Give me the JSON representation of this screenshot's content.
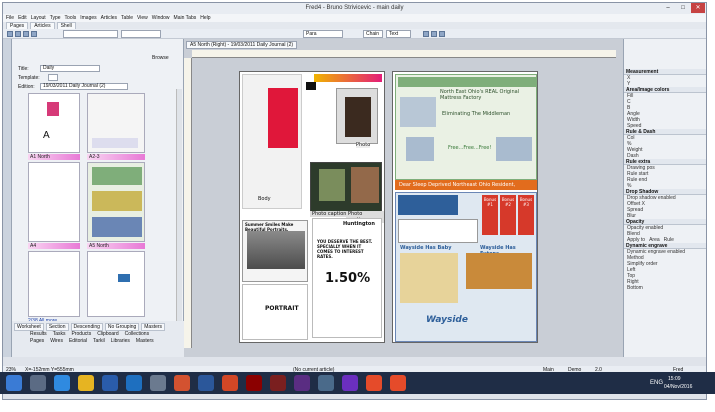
{
  "window": {
    "title": "Fred4 - Bruno Strivicevic - main daily",
    "min": "–",
    "max": "□",
    "close": "✕"
  },
  "menu": [
    "File",
    "Edit",
    "Layout",
    "Type",
    "Tools",
    "Images",
    "Articles",
    "Table",
    "View",
    "Window",
    "Main Tabs",
    "Help"
  ],
  "tabs": [
    "Pages",
    "Articles",
    "Shell"
  ],
  "toolbar": {
    "field1": "Para",
    "field2": "Chain",
    "field3": "Text"
  },
  "left_panel": {
    "browse_label": "Browse",
    "title_label": "Title:",
    "title_value": "Daily",
    "template_label": "Template:",
    "edition_label": "Edition:",
    "edition_value": "19/03/2011 Daily Journal (2)",
    "pages": [
      {
        "label": "A1 North"
      },
      {
        "label": "A2-3"
      },
      {
        "label": "A4"
      },
      {
        "label": "A5 North"
      }
    ],
    "more": "2/38 All more"
  },
  "bottom_left": {
    "row1": [
      "Worksheet",
      "Section",
      "Descending",
      "No Grouping"
    ],
    "row1_b": "Masters",
    "row2": [
      "Results",
      "Tasks",
      "Products",
      "Clipboard",
      "Collections"
    ],
    "row3": [
      "Pages",
      "Wires",
      "Editorial",
      "Tarkil",
      "Libraries",
      "Masters"
    ]
  },
  "document_tab": "A5 North (Right) - 19/03/2011 Daily Journal (2)",
  "ads": {
    "photo_caption": "Photo caption",
    "photo": "Photo",
    "body": "Body",
    "yes_deserve": "YOU DESERVE THE BEST. SPECIALLY WHEN IT COMES TO INTEREST RATES.",
    "huntington": "Huntington",
    "rate": "1.50%",
    "portrait": "PORTRAIT",
    "summer": "Summer Smiles Make Beautiful Portraits.",
    "factory": "North East Ohio's REAL Original Mattress Factory",
    "waste": "Eliminating The Middleman",
    "free": "Free...Free...Free!",
    "sleep": "Dear Sleep Deprived Northeast Ohio Resident,",
    "bonus1": "Bonus #1",
    "bonus2": "Bonus #2",
    "bonus3": "Bonus #3",
    "waysidebay": "Wayside Has Baby",
    "waysidefut": "Wayside Has Futons",
    "wayside": "Wayside"
  },
  "right_panel": {
    "sections": [
      {
        "title": "Measurement",
        "rows": [
          "X",
          "Y"
        ]
      },
      {
        "title": "Area/Image colors",
        "rows": [
          "Fill",
          "C",
          "B",
          "Angle",
          "Width",
          "Speed"
        ]
      },
      {
        "title": "Rule & Dash",
        "rows": [
          "Col",
          "%",
          "Weight",
          "Dash"
        ]
      },
      {
        "title": "Rule extra",
        "rows": [
          "Drawing pos",
          "Rule start",
          "Rule end",
          "%"
        ]
      },
      {
        "title": "Drop Shadow",
        "rows": [
          "Drop shadow enabled",
          "Offset X",
          "Spread",
          "Blur"
        ]
      },
      {
        "title": "Opacity",
        "rows": [
          "Opacity enabled",
          "Blend",
          "Apply to"
        ]
      },
      {
        "title": "Dynamic engrave",
        "rows": [
          "Dynamic engrave enabled",
          "Method",
          "Simplify order",
          "Left",
          "Top",
          "Right",
          "Bottom"
        ]
      }
    ],
    "apply_options": [
      "Area",
      "Rule"
    ]
  },
  "status": {
    "zoom": "23%",
    "coords": "X=-152mm Y=555mm",
    "article": "(No current article)",
    "mode": "Main",
    "demo": "Demo",
    "ver": "2.0",
    "user": "Fred"
  },
  "taskbar": {
    "time": "15:09",
    "date": "04/Nov/2016",
    "lang": "ENG"
  },
  "colors": {
    "accent": "#e879d6",
    "window": "#dfe3ea",
    "taskbar": "#1f2d46"
  }
}
